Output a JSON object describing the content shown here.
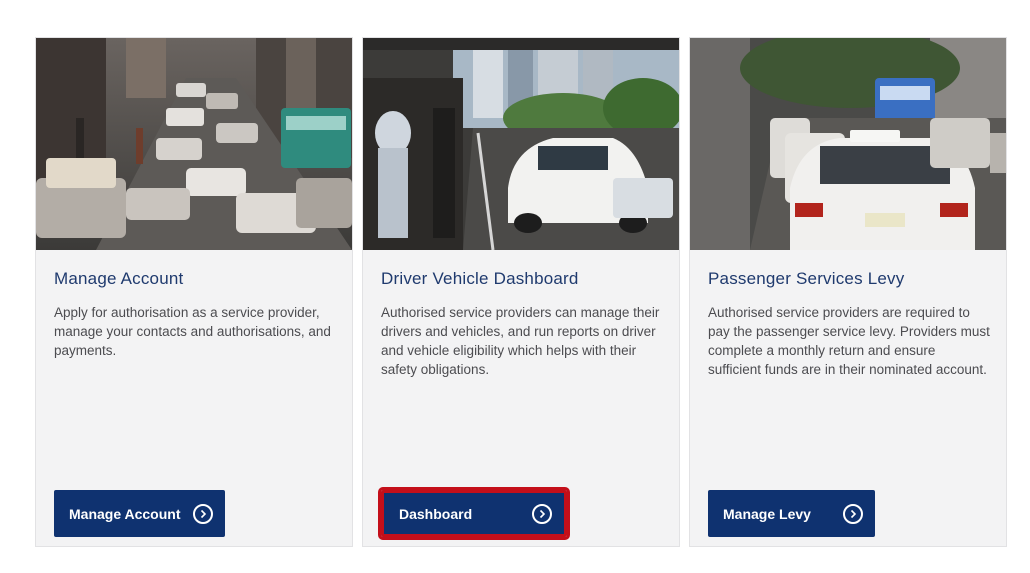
{
  "cards": [
    {
      "title": "Manage Account",
      "description": "Apply for authorisation as a service provider, manage your contacts and authorisations, and payments.",
      "button_label": "Manage Account",
      "button_icon": "chevron-right-circle-icon"
    },
    {
      "title": "Driver Vehicle Dashboard",
      "description": "Authorised service providers can manage their drivers and vehicles, and run reports on driver and vehicle eligibility which helps with their safety obligations.",
      "button_label": "Dashboard",
      "button_icon": "chevron-right-circle-icon",
      "highlight_color": "#c40f1a"
    },
    {
      "title": "Passenger Services Levy",
      "description": "Authorised service providers are required to pay the passenger service levy. Providers must complete a monthly return and ensure sufficient funds are in their nominated account.",
      "button_label": "Manage Levy",
      "button_icon": "chevron-right-circle-icon"
    }
  ],
  "colors": {
    "button_bg": "#0f3270",
    "title": "#1f3a6e",
    "card_bg": "#f3f3f4"
  }
}
